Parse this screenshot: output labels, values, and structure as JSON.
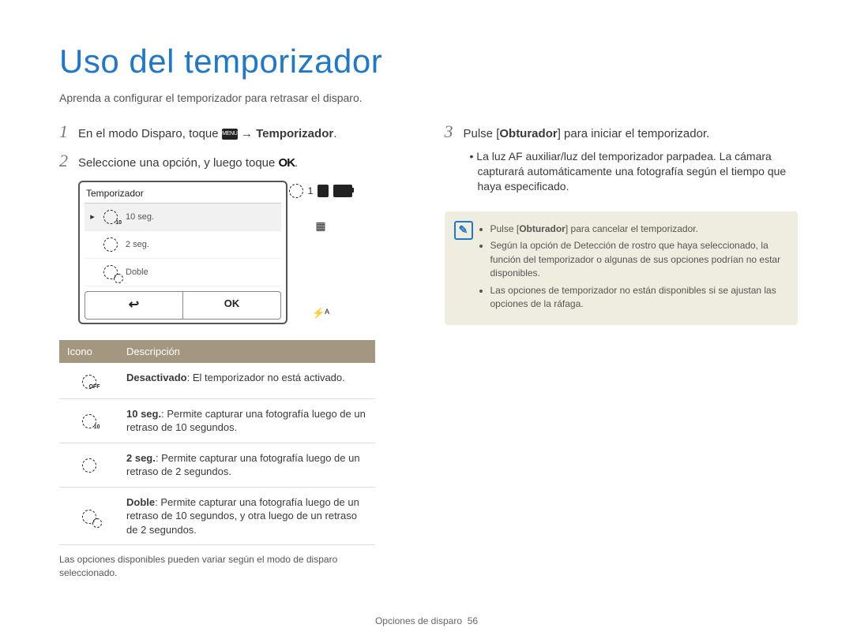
{
  "title": "Uso del temporizador",
  "subtitle": "Aprenda a configurar el temporizador para retrasar el disparo.",
  "steps": {
    "s1_pre": "En el modo Disparo, toque ",
    "s1_menu": "MENU",
    "s1_arrow": " → ",
    "s1_bold": "Temporizador",
    "s1_post": ".",
    "s2": "Seleccione una opción, y luego toque ",
    "s2_ok": "OK",
    "s2_post": ".",
    "s3_pre": "Pulse [",
    "s3_bold": "Obturador",
    "s3_post": "] para iniciar el temporizador.",
    "s3_sub": "• La luz AF auxiliar/luz del temporizador parpadea. La cámara capturará automáticamente una fotografía según el tiempo que haya especificado."
  },
  "lcd": {
    "title": "Temporizador",
    "items": [
      "10 seg.",
      "2 seg.",
      "Doble"
    ],
    "back": "↩",
    "ok": "OK",
    "counter": "1"
  },
  "side_icons": {
    "flash": "⚡ᴬ"
  },
  "table": {
    "h1": "Icono",
    "h2": "Descripción",
    "rows": [
      {
        "icon_sub": "OFF",
        "bold": "Desactivado",
        "rest": ": El temporizador no está activado."
      },
      {
        "icon_sub": "10",
        "bold": "10 seg.",
        "rest": ": Permite capturar una fotografía luego de un retraso de 10 segundos."
      },
      {
        "icon_sub": "",
        "bold": "2 seg.",
        "rest": ": Permite capturar una fotografía luego de un retraso de 2 segundos."
      },
      {
        "icon_doble": true,
        "bold": "Doble",
        "rest": ": Permite capturar una fotografía luego de un retraso de 10 segundos, y otra luego de un retraso de 2 segundos."
      }
    ]
  },
  "table_note": "Las opciones disponibles pueden variar según el modo de disparo seleccionado.",
  "infobox": {
    "items": [
      {
        "pre": "Pulse [",
        "bold": "Obturador",
        "post": "] para cancelar el temporizador."
      },
      {
        "pre": "Según la opción de Detección de rostro que haya seleccionado, la función del temporizador o algunas de sus opciones podrían no estar disponibles."
      },
      {
        "pre": "Las opciones de temporizador no están disponibles si se ajustan las opciones de la ráfaga."
      }
    ]
  },
  "footer": {
    "section": "Opciones de disparo",
    "page": "56"
  }
}
